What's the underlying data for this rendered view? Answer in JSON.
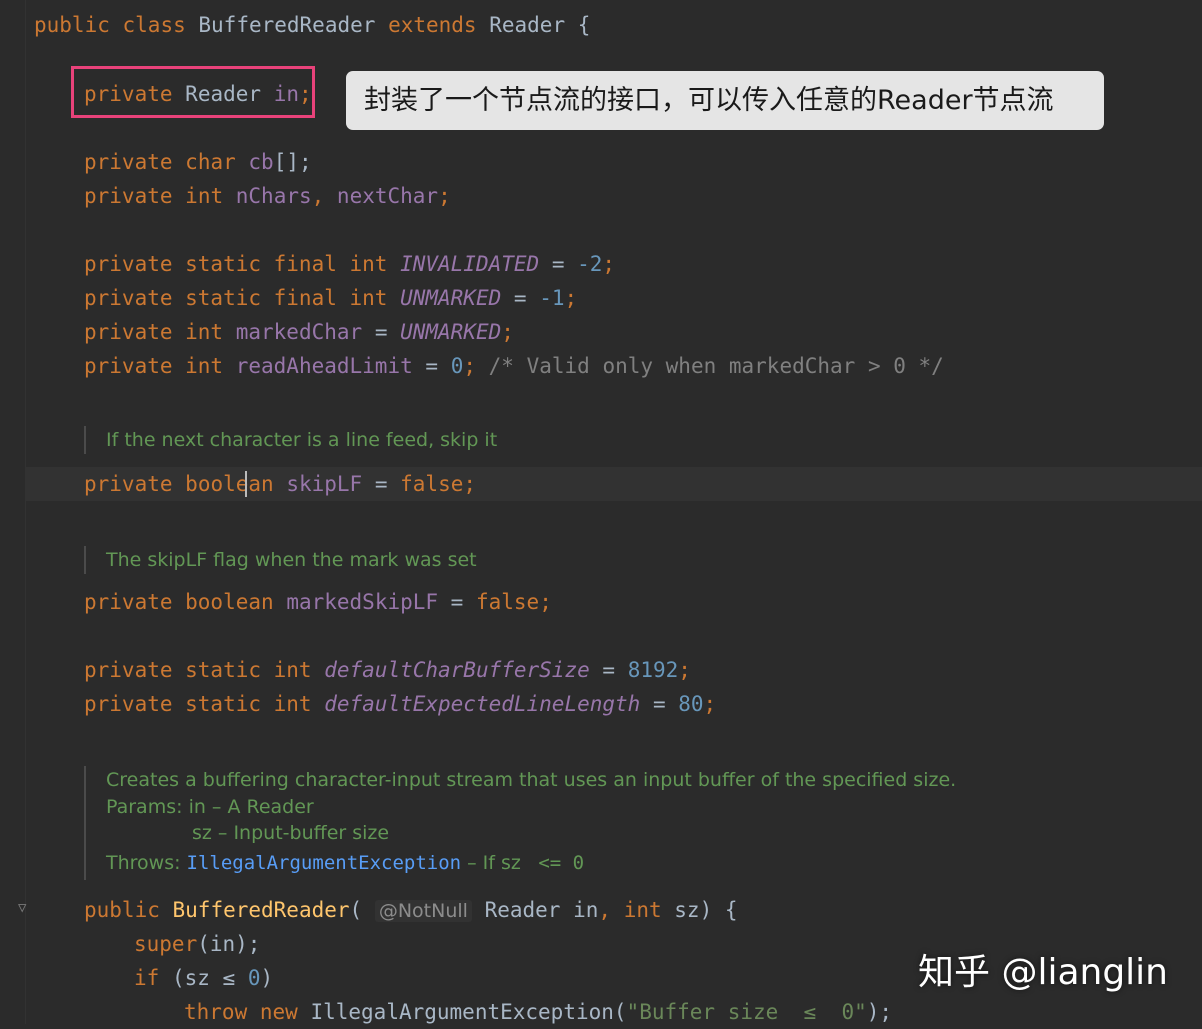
{
  "code": {
    "class_decl": {
      "kw1": "public",
      "kw2": "class",
      "name": "BufferedReader",
      "kw3": "extends",
      "parent": "Reader",
      "brace": "{"
    },
    "field_in": {
      "kw": "private",
      "type": "Reader",
      "name": "in",
      "end": ";"
    },
    "field_cb": {
      "kw1": "private",
      "kw2": "char",
      "name": "cb",
      "end": "[];"
    },
    "field_nchars": {
      "kw1": "private",
      "kw2": "int",
      "name1": "nChars",
      "sep": ", ",
      "name2": "nextChar",
      "end": ";"
    },
    "field_invalidated": {
      "kw": "private static final int",
      "name": "INVALIDATED",
      "eq": " = ",
      "value": "-2",
      "end": ";"
    },
    "field_unmarked": {
      "kw": "private static final int",
      "name": "UNMARKED",
      "eq": " = ",
      "value": "-1",
      "end": ";"
    },
    "field_markedchar": {
      "kw": "private int",
      "name": "markedChar",
      "eq": " = ",
      "value": "UNMARKED",
      "end": ";"
    },
    "field_readahead": {
      "kw": "private int",
      "name": "readAheadLimit",
      "eq": " = ",
      "value": "0",
      "end": ";",
      "comment": "/* Valid only when markedChar > 0 */"
    },
    "doc_skiplf": "If the next character is a line feed, skip it",
    "field_skiplf": {
      "kw1": "private",
      "kw2a": "boole",
      "kw2b": "an",
      "name": "skipLF",
      "eq": " = ",
      "value": "false",
      "end": ";"
    },
    "doc_markedskiplf": "The skipLF flag when the mark was set",
    "field_markedskiplf": {
      "kw": "private boolean",
      "name": "markedSkipLF",
      "eq": " = ",
      "value": "false",
      "end": ";"
    },
    "field_defaultbuf": {
      "kw": "private static int",
      "name": "defaultCharBufferSize",
      "eq": " = ",
      "value": "8192",
      "end": ";"
    },
    "field_defaultline": {
      "kw": "private static int",
      "name": "defaultExpectedLineLength",
      "eq": " = ",
      "value": "80",
      "end": ";"
    },
    "doc_ctor": {
      "line1": "Creates a buffering character-input stream that uses an input buffer of the specified size.",
      "params_label": "Params: ",
      "param1": "in – A Reader",
      "param2": "sz – Input-buffer size",
      "throws_label": "Throws: ",
      "throws_link": "IllegalArgumentException",
      "throws_text": " – If sz ",
      "throws_cond": " <= 0"
    },
    "ctor": {
      "kw": "public",
      "name": "BufferedReader",
      "open": "(",
      "annotation": "@NotNull",
      "ptype": " Reader ",
      "p1": "in",
      "sep": ", ",
      "kw2": "int",
      "p2": " sz",
      "close": ") {"
    },
    "super_line": {
      "kw": "super",
      "args": "(in);"
    },
    "if_line": {
      "kw": "if",
      "cond_open": " (sz ",
      "op": "≤",
      "num": "0",
      "close": ")"
    },
    "throw_line": {
      "kw1": "throw",
      "kw2": "new",
      "cls": " IllegalArgumentException(",
      "str": "\"Buffer size  ≤  0\"",
      "end": ");"
    }
  },
  "tooltip": {
    "text": "封装了一个节点流的接口，可以传入任意的Reader节点流"
  },
  "watermark": {
    "text": "知乎 @lianglin"
  },
  "colors": {
    "highlight_border": "#e8427a",
    "tooltip_bg": "#e5e5e5",
    "background": "#2b2b2b"
  }
}
